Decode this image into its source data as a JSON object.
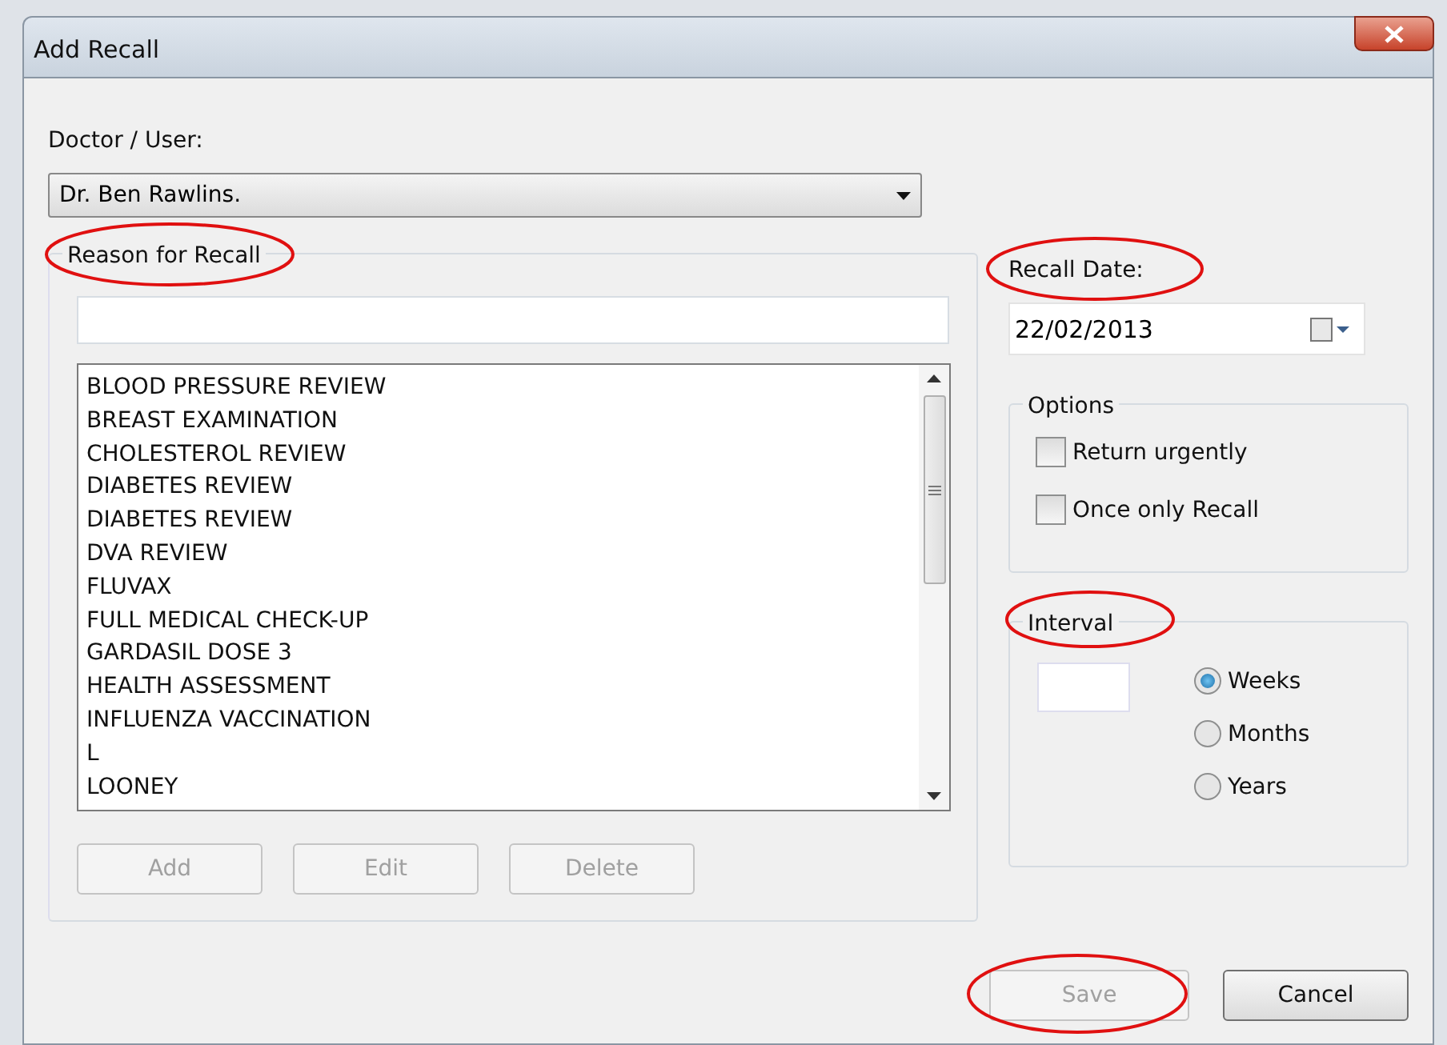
{
  "window": {
    "title": "Add Recall"
  },
  "doctor": {
    "label": "Doctor / User:",
    "value": "Dr. Ben Rawlins."
  },
  "reason": {
    "label": "Reason for Recall",
    "highlighted": true,
    "items": [
      "BLOOD PRESSURE REVIEW",
      "BREAST EXAMINATION",
      "CHOLESTEROL REVIEW",
      "DIABETES REVIEW",
      "DIABETES REVIEW",
      "DVA REVIEW",
      "FLUVAX",
      "FULL MEDICAL CHECK-UP",
      "GARDASIL DOSE 3",
      "HEALTH ASSESSMENT",
      "INFLUENZA VACCINATION",
      "L",
      "LOONEY"
    ],
    "buttons": [
      {
        "label": "Add",
        "disabled": true
      },
      {
        "label": "Edit",
        "disabled": true
      },
      {
        "label": "Delete",
        "disabled": true
      }
    ]
  },
  "recall_date": {
    "label": "Recall Date:",
    "highlighted": true,
    "value": "22/02/2013"
  },
  "options": {
    "label": "Options",
    "items": [
      {
        "label": "Return urgently",
        "checked": false
      },
      {
        "label": "Once only Recall",
        "checked": false
      }
    ]
  },
  "interval": {
    "label": "Interval",
    "highlighted": true,
    "units": [
      {
        "label": "Weeks",
        "selected": true
      },
      {
        "label": "Months",
        "selected": false
      },
      {
        "label": "Years",
        "selected": false
      }
    ]
  },
  "buttons": [
    {
      "label": "Save",
      "disabled": true,
      "highlighted": true
    },
    {
      "label": "Cancel",
      "disabled": false,
      "highlighted": false
    }
  ]
}
